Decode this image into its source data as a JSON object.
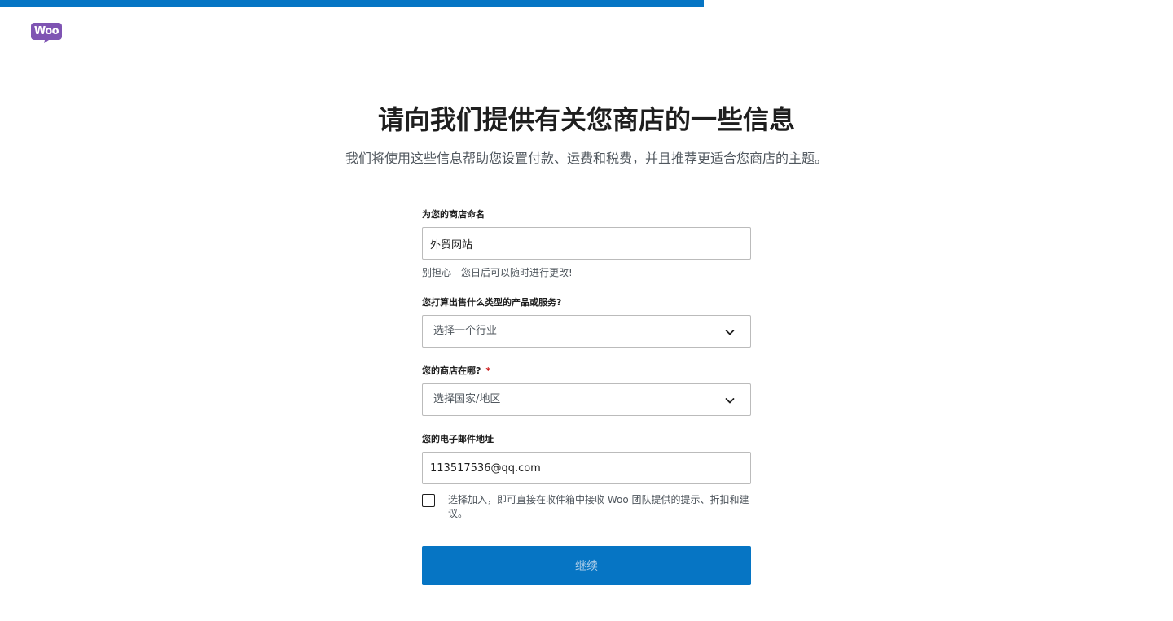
{
  "app": {
    "logo_text": "Woo",
    "brand_color": "#7f54b3",
    "accent_color": "#0675c4",
    "progress_percent": 60
  },
  "header": {
    "title": "请向我们提供有关您商店的一些信息",
    "subtitle": "我们将使用这些信息帮助您设置付款、运费和税费，并且推荐更适合您商店的主题。"
  },
  "form": {
    "store_name": {
      "label": "为您的商店命名",
      "value": "外贸网站",
      "help": "别担心 - 您日后可以随时进行更改!"
    },
    "industry": {
      "label": "您打算出售什么类型的产品或服务?",
      "placeholder": "选择一个行业",
      "icon": "chevron-down-icon"
    },
    "location": {
      "label": "您的商店在哪?",
      "required_mark": "*",
      "placeholder": "选择国家/地区",
      "icon": "chevron-down-icon"
    },
    "email": {
      "label": "您的电子邮件地址",
      "value": "113517536@qq.com"
    },
    "opt_in": {
      "checked": false,
      "label": "选择加入，即可直接在收件箱中接收 Woo 团队提供的提示、折扣和建议。"
    },
    "continue_label": "继续"
  }
}
